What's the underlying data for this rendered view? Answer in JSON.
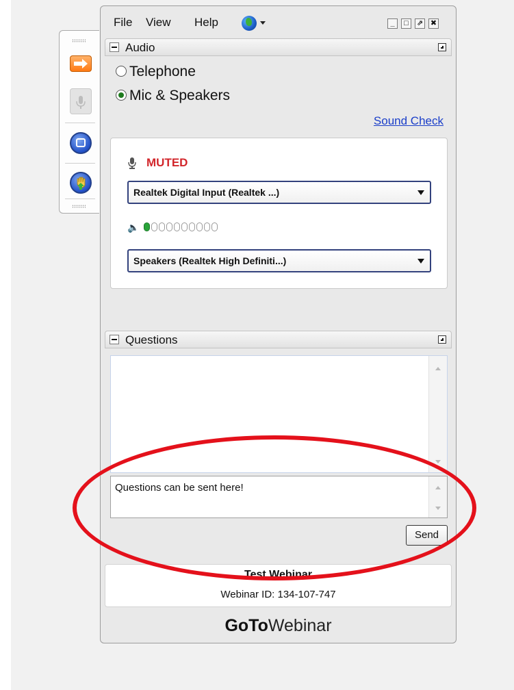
{
  "menu": {
    "file": "File",
    "view": "View",
    "help": "Help"
  },
  "window_controls": {
    "minimize": "_",
    "maximize": "□",
    "popout": "⇗",
    "close": "✖"
  },
  "audio": {
    "section_title": "Audio",
    "options": [
      {
        "label": "Telephone",
        "selected": false
      },
      {
        "label": "Mic & Speakers",
        "selected": true
      }
    ],
    "sound_check_link": "Sound Check",
    "mic_status": "MUTED",
    "mic_device": "Realtek Digital Input (Realtek ...)",
    "speaker_device": "Speakers (Realtek High Definiti...)",
    "speaker_level": {
      "lit_segments": 1,
      "total_segments": 10
    }
  },
  "questions": {
    "section_title": "Questions",
    "input_value": "Questions can be sent here!",
    "send_label": "Send"
  },
  "webinar": {
    "title": "Test Webinar",
    "id_text": "Webinar ID: 134-107-747"
  },
  "brand": {
    "bold": "GoTo",
    "rest": "Webinar"
  },
  "colors": {
    "muted": "#d2262b",
    "link": "#1a3ec9",
    "annotation": "#e4111b",
    "orange_button": "#ff7a14",
    "blue_button": "#2251c8"
  },
  "icons": [
    "arrow-right-icon",
    "microphone-icon",
    "screen-share-icon",
    "raise-hand-icon",
    "globe-icon",
    "speaker-icon"
  ]
}
